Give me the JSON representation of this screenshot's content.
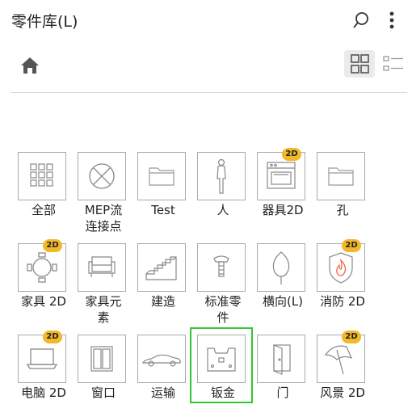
{
  "header": {
    "title": "零件库(L)"
  },
  "items": [
    {
      "label": "全部",
      "icon": "grid-icon"
    },
    {
      "label": "MEP流\n连接点",
      "icon": "circle-x-icon"
    },
    {
      "label": "Test",
      "icon": "folder-icon"
    },
    {
      "label": "人",
      "icon": "person-icon"
    },
    {
      "label": "器具2D",
      "icon": "oven-icon",
      "badge": "2D"
    },
    {
      "label": "孔",
      "icon": "folder-icon"
    },
    {
      "label": "家具 2D",
      "icon": "table-chairs-icon",
      "badge": "2D"
    },
    {
      "label": "家具元\n素",
      "icon": "armchair-icon"
    },
    {
      "label": "建造",
      "icon": "stairs-icon"
    },
    {
      "label": "标准零\n件",
      "icon": "bolt-icon"
    },
    {
      "label": "横向(L)",
      "icon": "tree-icon"
    },
    {
      "label": "消防 2D",
      "icon": "fire-shield-icon",
      "badge": "2D"
    },
    {
      "label": "电脑 2D",
      "icon": "laptop-icon",
      "badge": "2D"
    },
    {
      "label": "窗口",
      "icon": "window-icon"
    },
    {
      "label": "运输",
      "icon": "car-icon"
    },
    {
      "label": "钣金",
      "icon": "sheet-metal-icon",
      "selected": true
    },
    {
      "label": "门",
      "icon": "door-icon"
    },
    {
      "label": "风景 2D",
      "icon": "umbrella-icon",
      "badge": "2D"
    }
  ],
  "colors": {
    "badge": "#f3b82a",
    "selection": "#34c634"
  }
}
